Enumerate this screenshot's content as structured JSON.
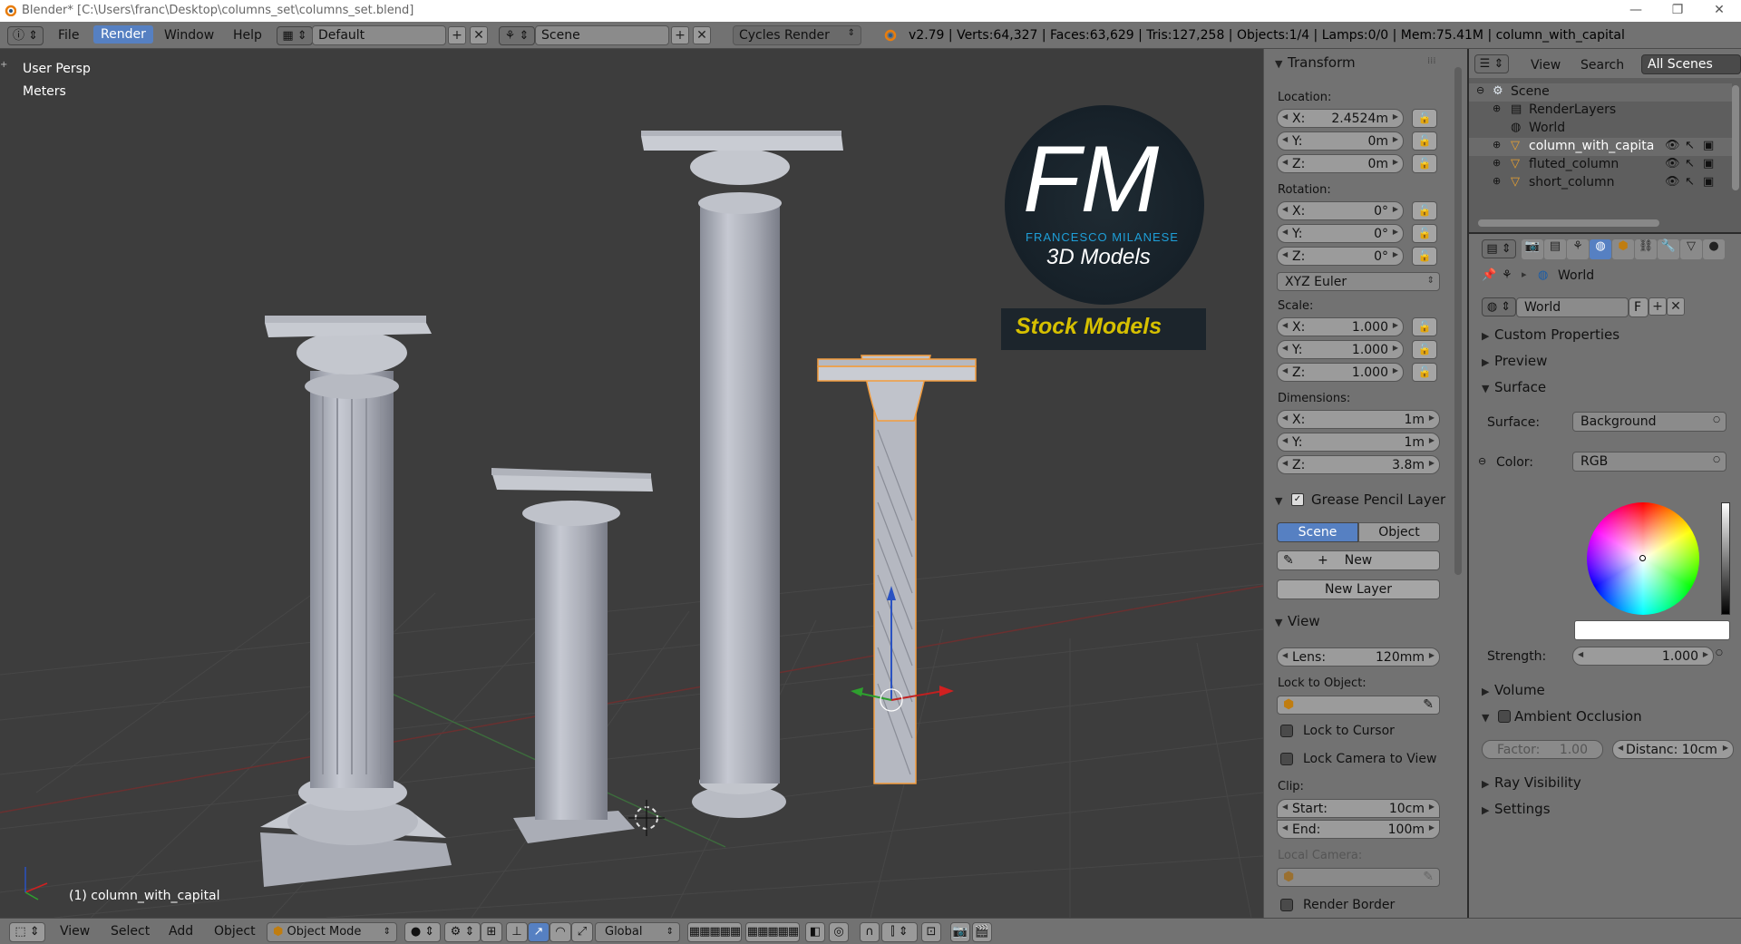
{
  "window": {
    "title": "Blender* [C:\\Users\\franc\\Desktop\\columns_set\\columns_set.blend]",
    "minimize": "—",
    "maximize": "❐",
    "close": "✕"
  },
  "header": {
    "menus": [
      "File",
      "Render",
      "Window",
      "Help"
    ],
    "active_menu": "Render",
    "screen_layout": "Default",
    "scene": "Scene",
    "render_engine": "Cycles Render",
    "stats": "v2.79 | Verts:64,327 | Faces:63,629 | Tris:127,258 | Objects:1/4 | Lamps:0/0 | Mem:75.41M | column_with_capital"
  },
  "viewport": {
    "view_name": "User Persp",
    "units": "Meters",
    "active_object": "(1) column_with_capital",
    "logo": {
      "initials": "FM",
      "name": "FRANCESCO MILANESE",
      "tagline": "3D Models",
      "badge": "Stock Models"
    }
  },
  "npanel": {
    "transform": {
      "header": "Transform",
      "location_label": "Location:",
      "location": [
        {
          "k": "X:",
          "v": "2.4524m"
        },
        {
          "k": "Y:",
          "v": "0m"
        },
        {
          "k": "Z:",
          "v": "0m"
        }
      ],
      "rotation_label": "Rotation:",
      "rotation": [
        {
          "k": "X:",
          "v": "0°"
        },
        {
          "k": "Y:",
          "v": "0°"
        },
        {
          "k": "Z:",
          "v": "0°"
        }
      ],
      "rotation_mode": "XYZ Euler",
      "scale_label": "Scale:",
      "scale": [
        {
          "k": "X:",
          "v": "1.000"
        },
        {
          "k": "Y:",
          "v": "1.000"
        },
        {
          "k": "Z:",
          "v": "1.000"
        }
      ],
      "dimensions_label": "Dimensions:",
      "dimensions": [
        {
          "k": "X:",
          "v": "1m"
        },
        {
          "k": "Y:",
          "v": "1m"
        },
        {
          "k": "Z:",
          "v": "3.8m"
        }
      ]
    },
    "grease_pencil": {
      "header": "Grease Pencil Layer",
      "tab_scene": "Scene",
      "tab_object": "Object",
      "new": "New",
      "new_layer": "New Layer"
    },
    "view": {
      "header": "View",
      "lens_label": "Lens:",
      "lens_value": "120mm",
      "lock_to_object": "Lock to Object:",
      "lock_to_cursor": "Lock to Cursor",
      "lock_camera": "Lock Camera to View",
      "clip_label": "Clip:",
      "clip_start_label": "Start:",
      "clip_start": "10cm",
      "clip_end_label": "End:",
      "clip_end": "100m",
      "local_camera": "Local Camera:",
      "render_border": "Render Border"
    }
  },
  "outliner": {
    "menus": [
      "View",
      "Search"
    ],
    "filter": "All Scenes",
    "items": [
      {
        "label": "Scene",
        "indent": 0
      },
      {
        "label": "RenderLayers",
        "indent": 1
      },
      {
        "label": "World",
        "indent": 1
      },
      {
        "label": "column_with_capita",
        "indent": 1
      },
      {
        "label": "fluted_column",
        "indent": 1
      },
      {
        "label": "short_column",
        "indent": 1
      }
    ]
  },
  "properties": {
    "breadcrumb": "World",
    "world_name": "World",
    "world_fake": "F",
    "panels": {
      "custom_properties": "Custom Properties",
      "preview": "Preview",
      "surface": "Surface",
      "volume": "Volume",
      "ambient_occlusion": "Ambient Occlusion",
      "ray_visibility": "Ray Visibility",
      "settings": "Settings"
    },
    "surface_label": "Surface:",
    "surface_value": "Background",
    "color_label": "Color:",
    "color_value": "RGB",
    "strength_label": "Strength:",
    "strength_value": "1.000",
    "ao_factor_label": "Factor:",
    "ao_factor": "1.00",
    "ao_distance": "Distanc: 10cm"
  },
  "bottombar": {
    "menus": [
      "View",
      "Select",
      "Add",
      "Object"
    ],
    "mode": "Object Mode",
    "orientation": "Global"
  },
  "colors": {
    "viewport_bg": "#3d3d3d",
    "panel_bg": "#727272",
    "active_blue": "#5680c2",
    "selected_outline": "#f39c3c",
    "logo_blue": "#1e9fd8",
    "logo_yellow": "#d6c000"
  }
}
